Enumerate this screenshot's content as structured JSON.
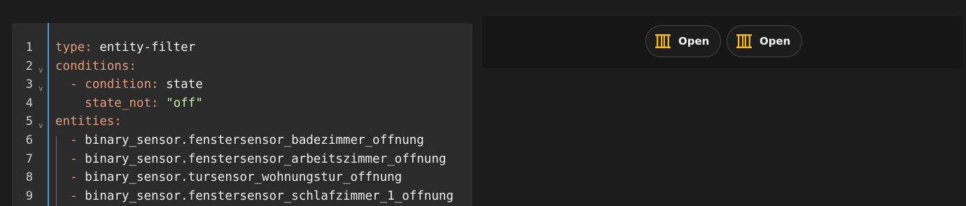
{
  "editor": {
    "lines": [
      {
        "num": "1",
        "fold": "",
        "indent": "",
        "dash": "",
        "key": "type",
        "colon": ":",
        "value": " entity-filter",
        "value_kind": "plain"
      },
      {
        "num": "2",
        "fold": "v",
        "indent": "",
        "dash": "",
        "key": "conditions",
        "colon": ":",
        "value": "",
        "value_kind": "plain"
      },
      {
        "num": "3",
        "fold": "v",
        "indent": "  ",
        "dash": "- ",
        "key": "condition",
        "colon": ":",
        "value": " state",
        "value_kind": "plain"
      },
      {
        "num": "4",
        "fold": "",
        "indent": "    ",
        "dash": "",
        "key": "state_not",
        "colon": ":",
        "value": " \"off\"",
        "value_kind": "string"
      },
      {
        "num": "5",
        "fold": "v",
        "indent": "",
        "dash": "",
        "key": "entities",
        "colon": ":",
        "value": "",
        "value_kind": "plain"
      },
      {
        "num": "6",
        "fold": "",
        "indent": "  ",
        "dash": "- ",
        "key": "",
        "colon": "",
        "value": "binary_sensor.fenstersensor_badezimmer_offnung",
        "value_kind": "plain"
      },
      {
        "num": "7",
        "fold": "",
        "indent": "  ",
        "dash": "- ",
        "key": "",
        "colon": "",
        "value": "binary_sensor.fenstersensor_arbeitszimmer_offnung",
        "value_kind": "plain"
      },
      {
        "num": "8",
        "fold": "",
        "indent": "  ",
        "dash": "- ",
        "key": "",
        "colon": "",
        "value": "binary_sensor.tursensor_wohnungstur_offnung",
        "value_kind": "plain"
      },
      {
        "num": "9",
        "fold": "",
        "indent": "  ",
        "dash": "- ",
        "key": "",
        "colon": "",
        "value": "binary_sensor.fenstersensor_schlafzimmer_1_offnung",
        "value_kind": "plain"
      }
    ]
  },
  "preview": {
    "chips": [
      {
        "label": "Open",
        "icon": "window-open-icon"
      },
      {
        "label": "Open",
        "icon": "window-open-icon"
      }
    ]
  },
  "colors": {
    "key": "#e59a7a",
    "string": "#cde8a0",
    "accent_bar": "#4a9be0",
    "icon": "#f5b820"
  }
}
